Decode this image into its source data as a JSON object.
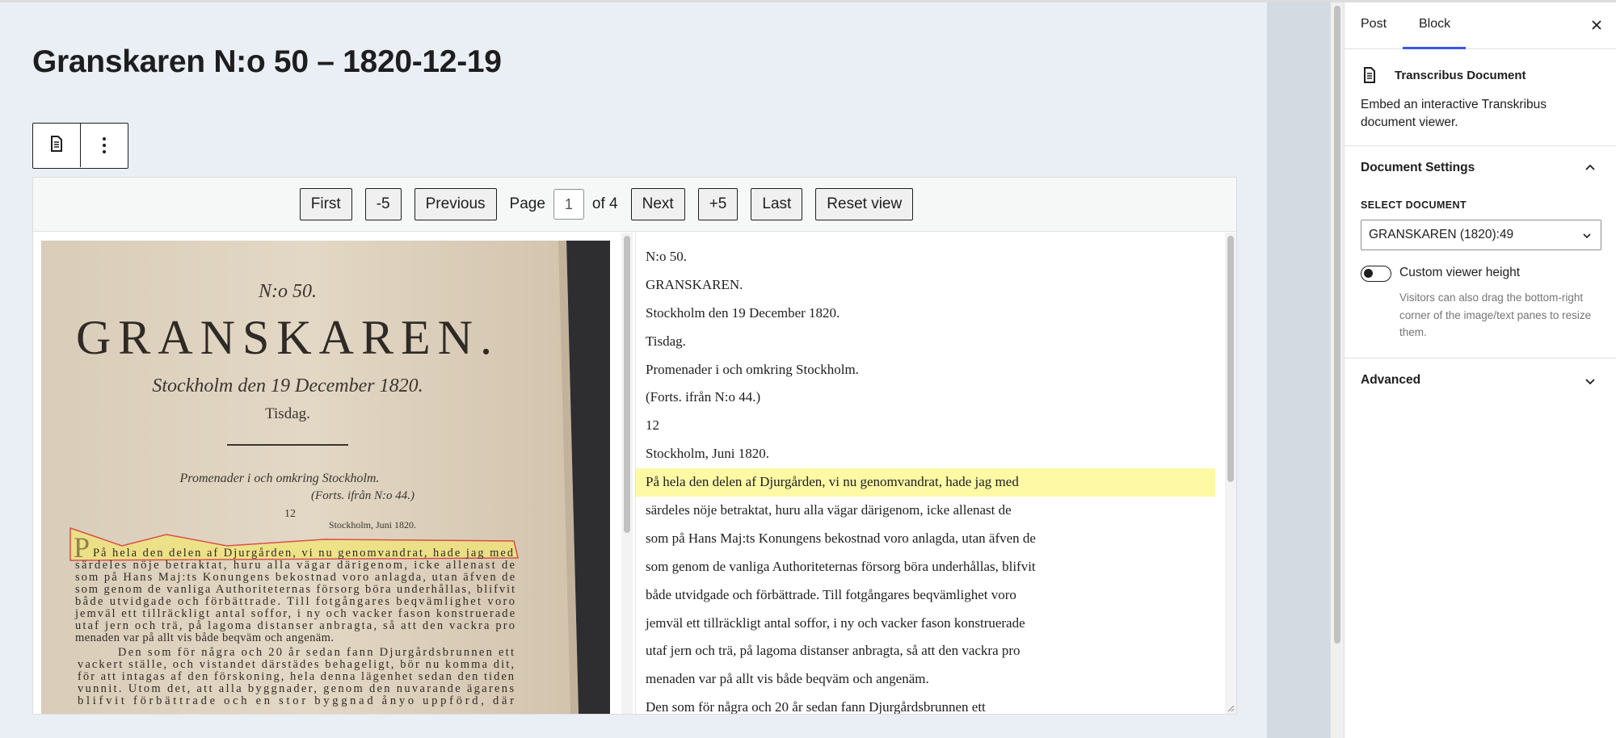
{
  "document": {
    "title": "Granskaren N:o 50 – 1820-12-19"
  },
  "block_toolbar": {
    "block_icon": "document-icon",
    "more_icon": "kebab-vertical-icon"
  },
  "viewer": {
    "nav": {
      "first": "First",
      "minus5": "-5",
      "previous": "Previous",
      "page_label": "Page",
      "page_value": "1",
      "of_total": "of 4",
      "next": "Next",
      "plus5": "+5",
      "last": "Last",
      "reset": "Reset view"
    },
    "scan": {
      "issue": "N:o 50.",
      "masthead": "GRANSKAREN.",
      "dateline": "Stockholm den 19 December 1820.",
      "weekday": "Tisdag.",
      "headline": "Promenader i och omkring Stockholm.",
      "continued": "(Forts. ifrån N:o 44.)",
      "number": "12",
      "place": "Stockholm, Juni 1820.",
      "body": [
        "På hela den delen af Djurgården, vi nu genomvandrat, hade jag med",
        "särdeles nöje betraktat, huru alla vägar därigenom, icke allenast de",
        "som på Hans Maj:ts Konungens bekostnad voro anlagda, utan äfven de",
        "som genom de vanliga Authoriteternas försorg böra underhållas, blifvit",
        "både utvidgade och förbättrade. Till fotgångares beqvämlighet voro",
        "jemväl ett tillräckligt antal soffor, i ny och vacker fason konstruerade",
        "utaf jern och trä, på lagoma distanser anbragta, så att den vackra pro",
        "menaden var på allt vis både beqväm och angenäm.",
        "Den som för några och 20 år sedan fann Djurgårdsbrunnen ett",
        "vackert ställe, och vistandet därstädes behageligt, bör nu komma dit,",
        "för att intagas af den förskoning, hela denna lägenhet sedan den tiden",
        "vunnit. Utom det, att alla byggnader, genom den nuvarande ägarens",
        "blifvit förbättrade och en stor byggnad ånyo uppförd, där"
      ]
    },
    "text_lines": [
      "N:o 50.",
      "GRANSKAREN.",
      "Stockholm den 19 December 1820.",
      "Tisdag.",
      "Promenader i och omkring Stockholm.",
      "(Forts. ifrån N:o 44.)",
      "12",
      "Stockholm, Juni 1820.",
      "På hela den delen af Djurgården, vi nu genomvandrat, hade jag med",
      "särdeles nöje betraktat, huru alla vägar därigenom, icke allenast de",
      "som på Hans Maj:ts Konungens bekostnad voro anlagda, utan äfven de",
      "som genom de vanliga Authoriteternas försorg böra underhållas, blifvit",
      "både utvidgade och förbättrade. Till fotgångares beqvämlighet voro",
      "jemväl ett tillräckligt antal soffor, i ny och vacker fason konstruerade",
      "utaf jern och trä, på lagoma distanser anbragta, så att den vackra pro",
      "menaden var på allt vis både beqväm och angenäm.",
      "Den som för några och 20 år sedan fann Djurgårdsbrunnen ett"
    ],
    "highlighted_line": 8,
    "highlight_color": "#fdf9a5"
  },
  "sidebar": {
    "tabs": [
      "Post",
      "Block"
    ],
    "active_tab": "Block",
    "close_icon": "close-icon",
    "block": {
      "name": "Transcribus Document",
      "description": "Embed an interactive Transkribus document viewer."
    },
    "document_settings": {
      "heading": "Document Settings",
      "expanded": true,
      "select_label": "SELECT DOCUMENT",
      "selected": "GRANSKAREN (1820):49",
      "toggle_label": "Custom viewer height",
      "toggle_on": false,
      "help": "Visitors can also drag the bottom-right corner of the image/text panes to resize them."
    },
    "advanced": {
      "heading": "Advanced",
      "expanded": false
    }
  },
  "colors": {
    "accent": "#3858e9",
    "canvas": "#eaeff5"
  }
}
